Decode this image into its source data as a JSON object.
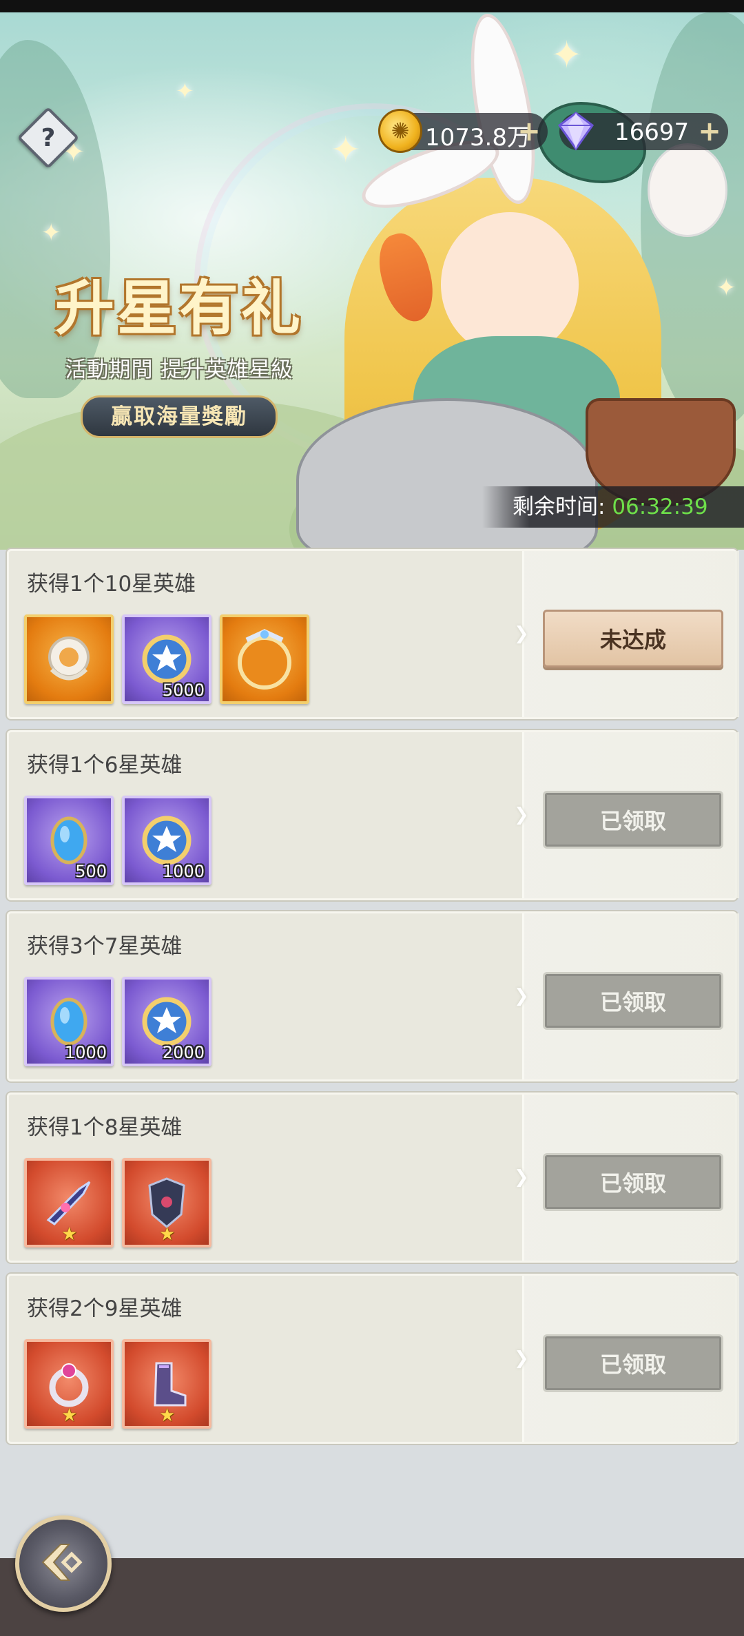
{
  "header": {
    "currencies": {
      "gold": {
        "value": "1073.8万",
        "icon": "gold-coin-icon"
      },
      "gem": {
        "value": "16697",
        "icon": "diamond-icon"
      }
    },
    "help_icon": "?"
  },
  "banner": {
    "title": "升星有礼",
    "subtitle": "活動期間  提升英雄星級",
    "ribbon": "贏取海量獎勵",
    "timer_label": "剩余时间:",
    "timer_value": "06:32:39"
  },
  "tasks": [
    {
      "title": "获得1个10星英雄",
      "button": "未达成",
      "button_state": "active",
      "rewards": [
        {
          "icon": "silver-emblem-icon",
          "bg": "orange",
          "count": ""
        },
        {
          "icon": "star-medal-icon",
          "bg": "purple",
          "count": "5000"
        },
        {
          "icon": "golden-frame-icon",
          "bg": "orange",
          "count": ""
        }
      ]
    },
    {
      "title": "获得1个6星英雄",
      "button": "已领取",
      "button_state": "disabled",
      "rewards": [
        {
          "icon": "blue-crystal-icon",
          "bg": "purple",
          "count": "500"
        },
        {
          "icon": "star-medal-icon",
          "bg": "purple",
          "count": "1000"
        }
      ]
    },
    {
      "title": "获得3个7星英雄",
      "button": "已领取",
      "button_state": "disabled",
      "rewards": [
        {
          "icon": "blue-crystal-icon",
          "bg": "purple",
          "count": "1000"
        },
        {
          "icon": "star-medal-icon",
          "bg": "purple",
          "count": "2000"
        }
      ]
    },
    {
      "title": "获得1个8星英雄",
      "button": "已领取",
      "button_state": "disabled",
      "rewards": [
        {
          "icon": "blade-weapon-icon",
          "bg": "red",
          "star": true
        },
        {
          "icon": "armor-icon",
          "bg": "red",
          "star": true
        }
      ]
    },
    {
      "title": "获得2个9星英雄",
      "button": "已领取",
      "button_state": "disabled",
      "rewards": [
        {
          "icon": "ring-icon",
          "bg": "red",
          "star": true
        },
        {
          "icon": "boots-icon",
          "bg": "red",
          "star": true
        }
      ]
    }
  ],
  "footer": {
    "back_icon": "back-arrow-icon"
  }
}
